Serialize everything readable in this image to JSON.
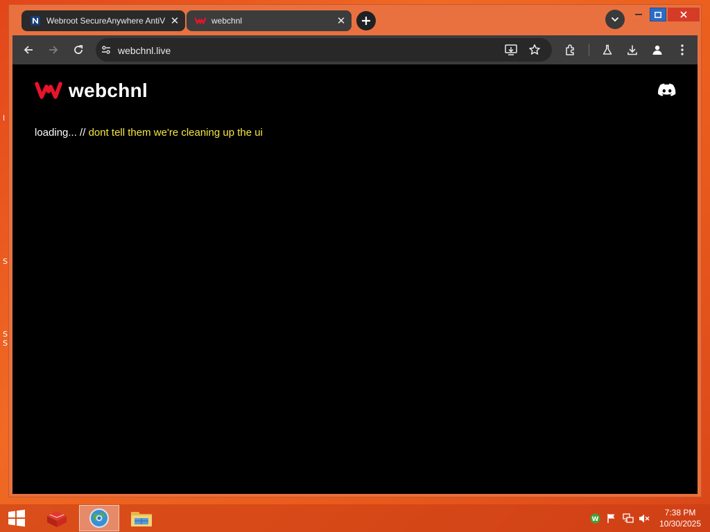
{
  "browser": {
    "tabs": [
      {
        "title": "Webroot SecureAnywhere AntiV",
        "active": false
      },
      {
        "title": "webchnl",
        "active": true
      }
    ],
    "url": "webchnl.live"
  },
  "page": {
    "logo_text": "webchnl",
    "loading_prefix": "loading... // ",
    "loading_message": "dont tell them we're cleaning up the ui",
    "accent_color": "#e8132c",
    "message_color": "#f5e642"
  },
  "desktop": {
    "fragments": [
      "l",
      "S",
      "S",
      "S"
    ]
  },
  "taskbar": {
    "time": "7:38 PM",
    "date": "10/30/2025"
  }
}
